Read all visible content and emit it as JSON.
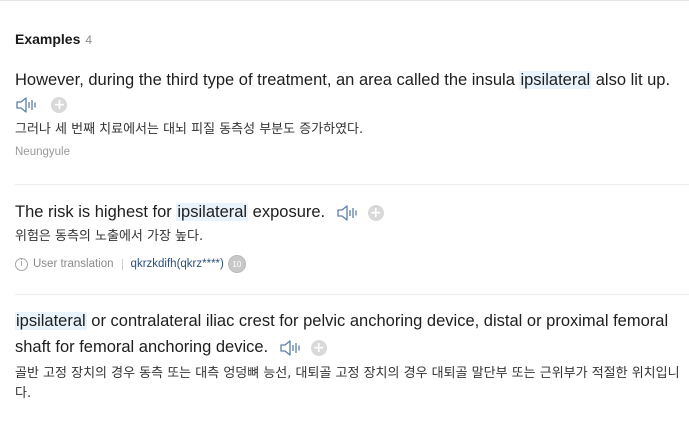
{
  "section": {
    "title": "Examples",
    "count": "4"
  },
  "examples": [
    {
      "en_before": "However, during the third type of treatment, an area called the insula ",
      "en_highlight": "ipsilateral",
      "en_after": " also lit up.",
      "ko": "그러나 세 번째 치료에서는 대뇌 피질 동측성 부분도 증가하였다.",
      "source": "Neungyule"
    },
    {
      "en_before": "The risk is highest for ",
      "en_highlight": "ipsilateral",
      "en_after": " exposure.",
      "ko": "위험은 동측의 노출에서 가장 높다.",
      "user_translation_label": "User translation",
      "user_name": "qkrzkdifh(qkrz****)",
      "user_level": "10"
    },
    {
      "en_highlight": "ipsilateral",
      "en_after": " or contralateral iliac crest for pelvic anchoring device, distal or proximal femoral shaft for femoral anchoring device.",
      "ko": "골반 고정 장치의 경우 동측 또는 대측 엉덩뼈 능선, 대퇴골 고정 장치의 경우 대퇴골 말단부 또는 근위부가 적절한 위치입니다."
    }
  ],
  "icons": {
    "speaker": "speaker-icon",
    "add": "plus-icon",
    "info": "info-icon"
  },
  "colors": {
    "highlight_bg": "#e8f3fb",
    "user_link": "#2d4f7c",
    "icon_gray": "#d9d9d9"
  }
}
